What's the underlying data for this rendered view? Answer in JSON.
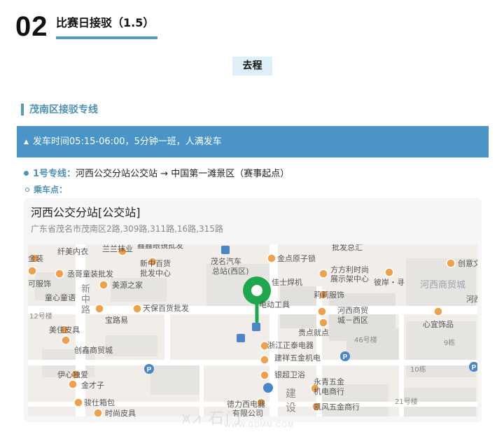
{
  "section": {
    "number": "02",
    "title": "比赛日接驳（1.5）"
  },
  "route_tag": "去程",
  "district_title": "茂南区接驳专线",
  "departure_banner": "发车时间05:15-06:00，5分钟一班，人满发车",
  "line": {
    "label": "1号专线：",
    "route": "河西公交分站公交站 → 中国第一滩景区（赛事起点）"
  },
  "boarding_label": "乘车点：",
  "stop_card": {
    "name": "河西公交分站[公交站]",
    "address": "广东省茂名市茂南区2路,309路,311路,16路,315路"
  },
  "map": {
    "labels": {
      "l01": "纤美内衣",
      "l02": "兰兰抹业",
      "l03": "鑫鑫眼镜批发",
      "l04": "批发总汇",
      "l05": "茂名汽车",
      "l06": "总站(西区)",
      "l07": "金点原子锁",
      "l08": "创意文",
      "l09": "金装",
      "l10": "丞哥童装批发",
      "l11": "新中百货",
      "l12": "批发中心",
      "l13": "方方利时尚",
      "l14": "展示架中心",
      "l15": "彼岸・寻",
      "l16": "河西商贸城",
      "l17": "可服饰",
      "l18": "美源之家",
      "l19": "佳士焊机",
      "l20": "新",
      "l21": "中",
      "l22": "路",
      "l23": "童心童语",
      "l24": "莉莉服饰",
      "l25": "河西",
      "l26": "天保百货批发",
      "l27": "电动工具",
      "l28": "河西商贸",
      "l29": "城－西区",
      "l30": "12号楼",
      "l31": "宝路易",
      "l32": "心宜饰品",
      "l33": "美佳皮具",
      "l34": "贵点就点",
      "l35": "46号楼",
      "l36": "创鑫商贸城",
      "l37": "浙江正泰电器",
      "l38": "9栋",
      "l39": "建祥五金机电",
      "l40": "伊心独爱",
      "l41": "银超卫浴",
      "l42": "10栋",
      "l43": "金才子",
      "l44": "永青五金",
      "l45": "机电商行",
      "l46": "骏仕箱包",
      "l47": "建",
      "l48": "设",
      "l49": "凯风五金商行",
      "l50": "21号楼",
      "l51": "德力西电器",
      "l52": "有限公司",
      "l53": "时尚皮具"
    },
    "colors": {
      "background": "#f1eeea",
      "block": "#e5e3df",
      "road": "#ffffff",
      "poi": "#f0a04b",
      "label": "#555555",
      "pin": "#1fa74e",
      "transit": "#4a86c7"
    },
    "icons": [
      "location-pin-icon",
      "bus-stop-icon",
      "parking-icon",
      "subway-icon"
    ]
  },
  "watermark": {
    "mark": "⩙⩘ 石门",
    "url": "WWW.GDMM.COM"
  }
}
